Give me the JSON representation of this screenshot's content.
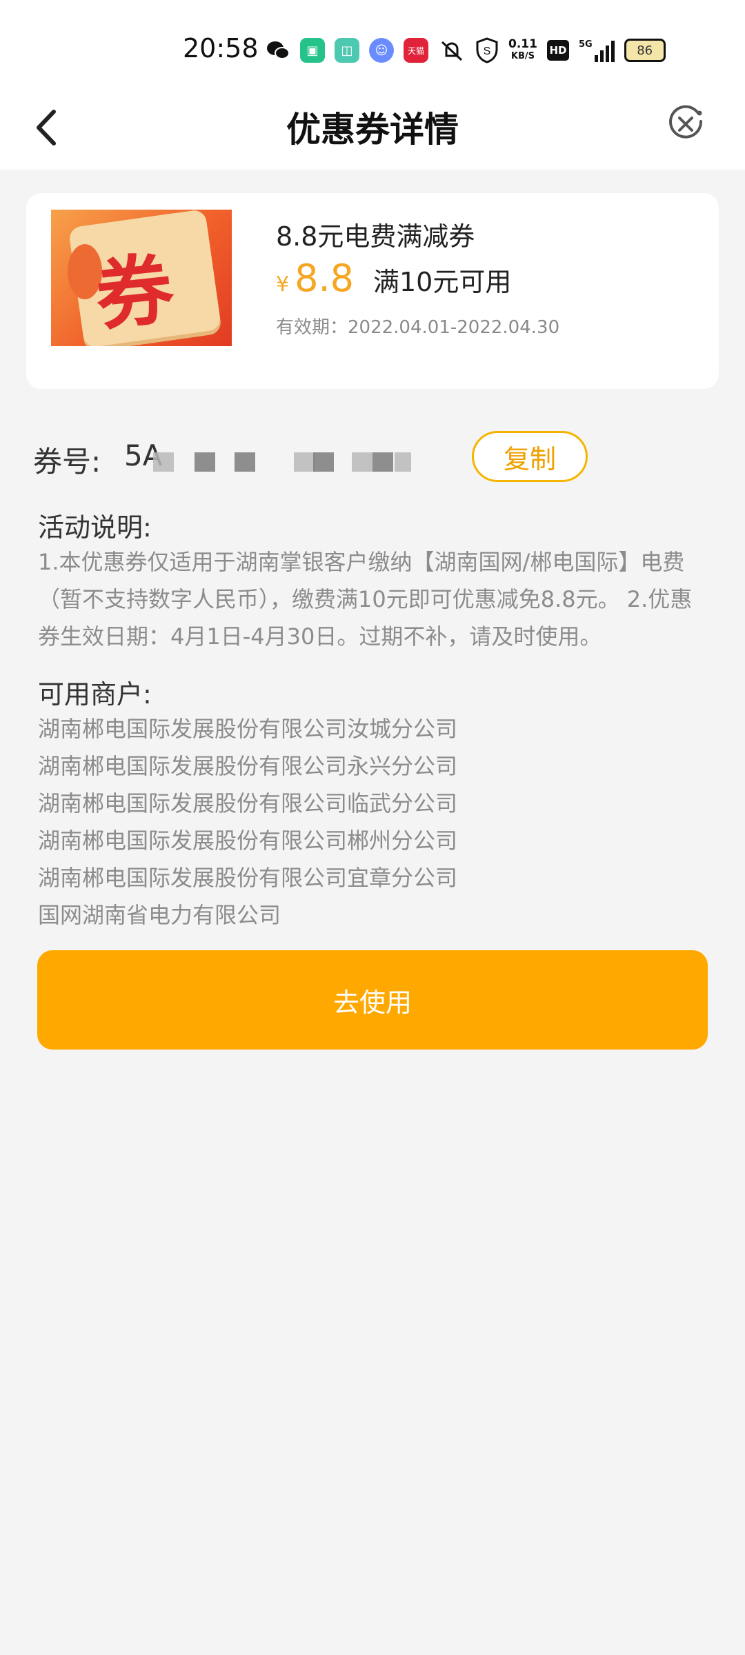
{
  "status_bar": {
    "time": "20:58",
    "net_speed_value": "0.11",
    "net_speed_unit": "KB/S",
    "hd_label": "HD",
    "signal_label": "5G",
    "battery": "86",
    "app_icon_text": "天猫"
  },
  "nav": {
    "title": "优惠券详情"
  },
  "coupon": {
    "image_char": "券",
    "name": "8.8元电费满减券",
    "currency": "¥",
    "amount": "8.8",
    "threshold": "满10元可用",
    "validity": "有效期：2022.04.01-2022.04.30"
  },
  "code": {
    "label": "券号:",
    "value_visible": "5A",
    "copy_label": "复制"
  },
  "activity": {
    "title": "活动说明:",
    "text": "1.本优惠券仅适用于湖南掌银客户缴纳【湖南国网/郴电国际】电费（暂不支持数字人民币），缴费满10元即可优惠减免8.8元。 2.优惠券生效日期：4月1日-4月30日。过期不补，请及时使用。"
  },
  "merchants": {
    "title": "可用商户:",
    "items": [
      "湖南郴电国际发展股份有限公司汝城分公司",
      "湖南郴电国际发展股份有限公司永兴分公司",
      "湖南郴电国际发展股份有限公司临武分公司",
      "湖南郴电国际发展股份有限公司郴州分公司",
      "湖南郴电国际发展股份有限公司宜章分公司",
      "国网湖南省电力有限公司"
    ]
  },
  "action": {
    "use_label": "去使用"
  },
  "colors": {
    "accent": "#ffa800",
    "price": "#f5a623",
    "muted_text": "#8c8c8c",
    "background": "#f4f4f4"
  }
}
